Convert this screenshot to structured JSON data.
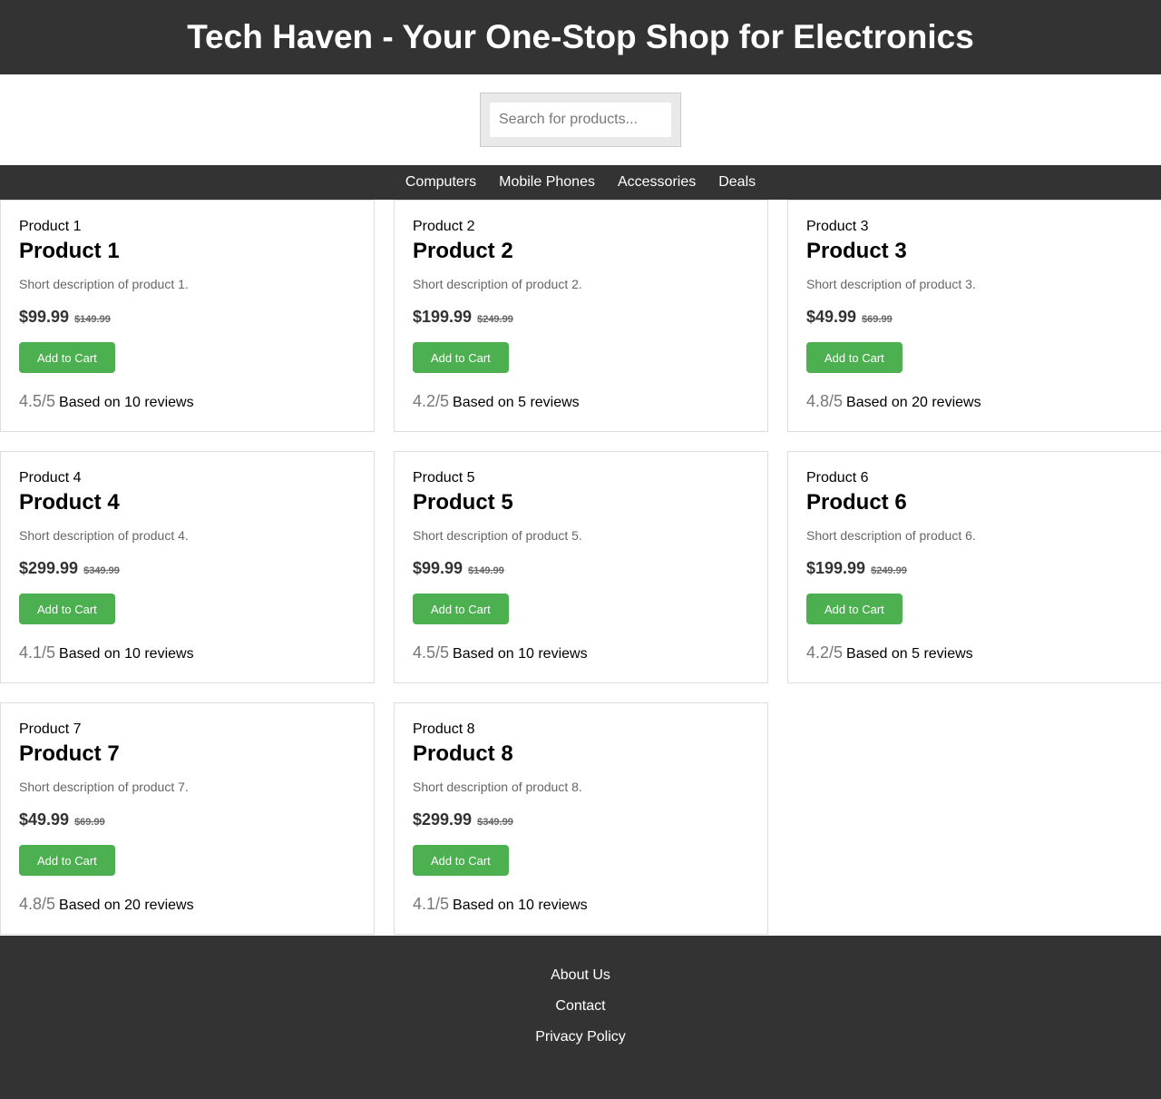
{
  "header": {
    "title": "Tech Haven - Your One-Stop Shop for Electronics"
  },
  "search": {
    "placeholder": "Search for products..."
  },
  "nav": {
    "items": [
      "Computers",
      "Mobile Phones",
      "Accessories",
      "Deals"
    ]
  },
  "products": [
    {
      "img_alt": "Product 1",
      "name": "Product 1",
      "description": "Short description of product 1.",
      "price": "$99.99",
      "old_price": "$149.99",
      "button": "Add to Cart",
      "rating": "4.5/5",
      "reviews": "Based on 10 reviews"
    },
    {
      "img_alt": "Product 2",
      "name": "Product 2",
      "description": "Short description of product 2.",
      "price": "$199.99",
      "old_price": "$249.99",
      "button": "Add to Cart",
      "rating": "4.2/5",
      "reviews": "Based on 5 reviews"
    },
    {
      "img_alt": "Product 3",
      "name": "Product 3",
      "description": "Short description of product 3.",
      "price": "$49.99",
      "old_price": "$69.99",
      "button": "Add to Cart",
      "rating": "4.8/5",
      "reviews": "Based on 20 reviews"
    },
    {
      "img_alt": "Product 4",
      "name": "Product 4",
      "description": "Short description of product 4.",
      "price": "$299.99",
      "old_price": "$349.99",
      "button": "Add to Cart",
      "rating": "4.1/5",
      "reviews": "Based on 10 reviews"
    },
    {
      "img_alt": "Product 5",
      "name": "Product 5",
      "description": "Short description of product 5.",
      "price": "$99.99",
      "old_price": "$149.99",
      "button": "Add to Cart",
      "rating": "4.5/5",
      "reviews": "Based on 10 reviews"
    },
    {
      "img_alt": "Product 6",
      "name": "Product 6",
      "description": "Short description of product 6.",
      "price": "$199.99",
      "old_price": "$249.99",
      "button": "Add to Cart",
      "rating": "4.2/5",
      "reviews": "Based on 5 reviews"
    },
    {
      "img_alt": "Product 7",
      "name": "Product 7",
      "description": "Short description of product 7.",
      "price": "$49.99",
      "old_price": "$69.99",
      "button": "Add to Cart",
      "rating": "4.8/5",
      "reviews": "Based on 20 reviews"
    },
    {
      "img_alt": "Product 8",
      "name": "Product 8",
      "description": "Short description of product 8.",
      "price": "$299.99",
      "old_price": "$349.99",
      "button": "Add to Cart",
      "rating": "4.1/5",
      "reviews": "Based on 10 reviews"
    }
  ],
  "footer": {
    "links": [
      "About Us",
      "Contact",
      "Privacy Policy"
    ]
  },
  "colors": {
    "header_bg": "#333333",
    "button_green": "#4caf50"
  }
}
